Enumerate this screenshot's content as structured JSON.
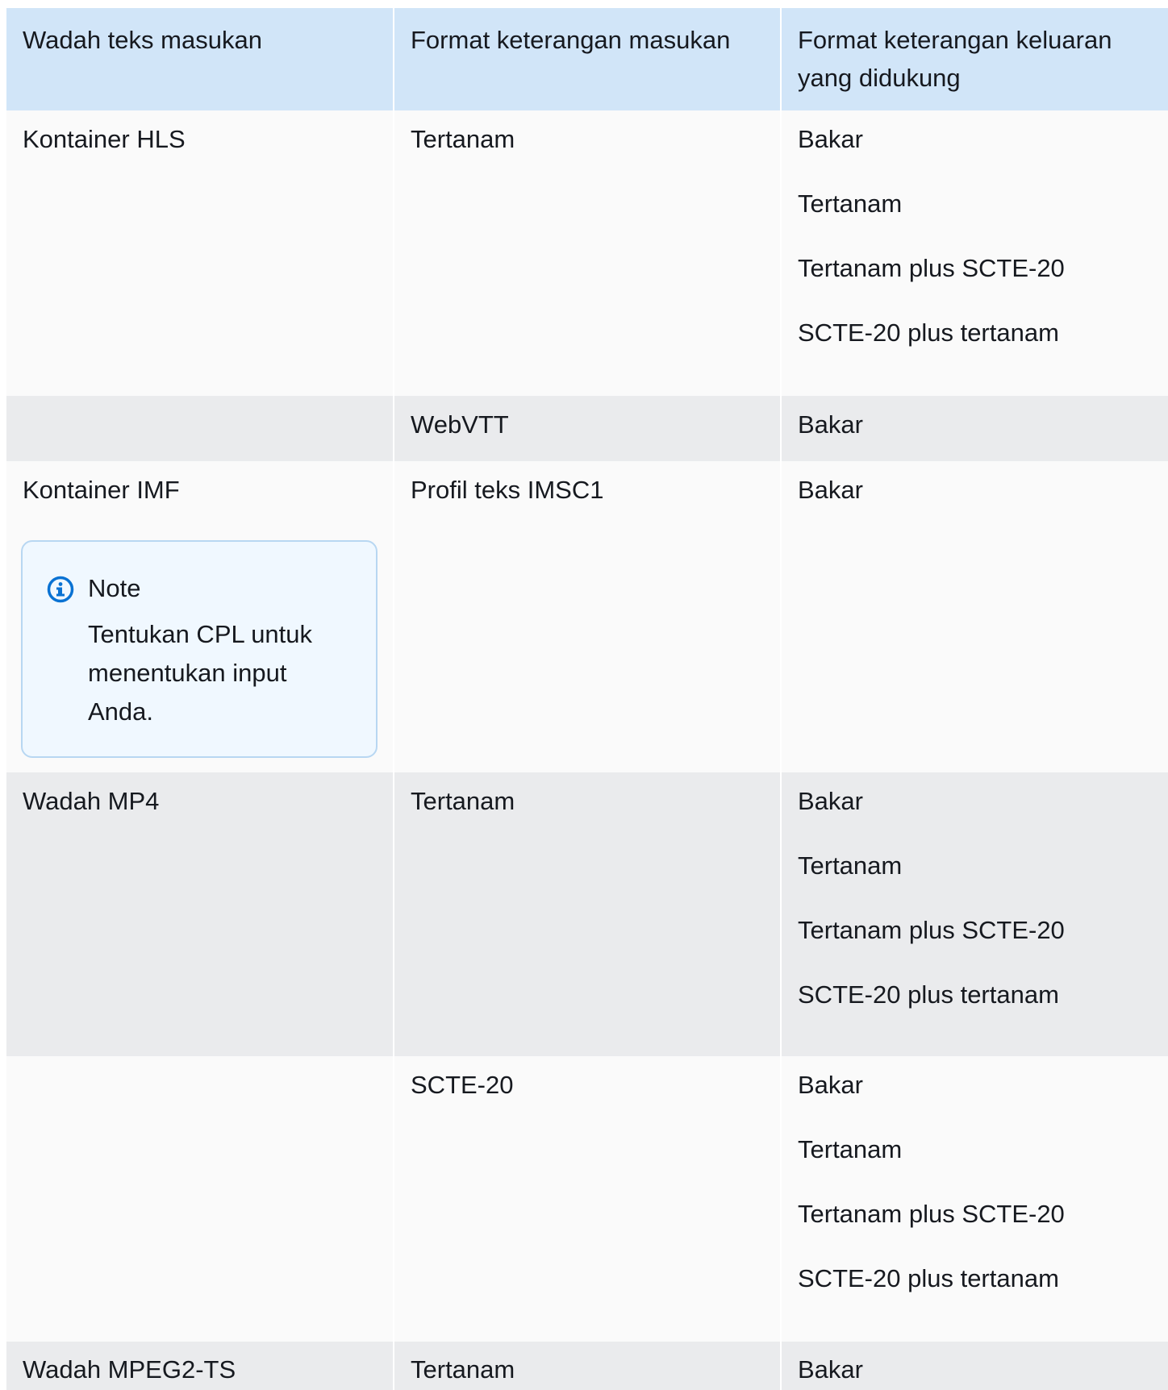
{
  "table": {
    "headers": [
      "Wadah teks masukan",
      "Format keterangan masukan",
      "Format keterangan keluaran yang didukung"
    ],
    "rows": [
      {
        "container": "Kontainer HLS",
        "input_format": "Tertanam",
        "outputs": [
          "Bakar",
          "Tertanam",
          "Tertanam plus SCTE-20",
          "SCTE-20 plus tertanam"
        ]
      },
      {
        "container": "",
        "input_format": "WebVTT",
        "outputs": [
          "Bakar"
        ]
      },
      {
        "container": "Kontainer IMF",
        "input_format": "Profil teks IMSC1",
        "outputs": [
          "Bakar"
        ],
        "note": {
          "title": "Note",
          "body": "Tentukan CPL untuk menentukan input Anda.",
          "icon": "info-icon"
        }
      },
      {
        "container": "Wadah MP4",
        "input_format": "Tertanam",
        "outputs": [
          "Bakar",
          "Tertanam",
          "Tertanam plus SCTE-20",
          "SCTE-20 plus tertanam"
        ]
      },
      {
        "container": "",
        "input_format": "SCTE-20",
        "outputs": [
          "Bakar",
          "Tertanam",
          "Tertanam plus SCTE-20",
          "SCTE-20 plus tertanam"
        ]
      },
      {
        "container": "Wadah MPEG2-TS",
        "input_format": "Tertanam",
        "outputs": [
          "Bakar"
        ]
      }
    ]
  },
  "colors": {
    "header_bg": "#d1e5f8",
    "row_light": "#fafafa",
    "row_shaded": "#eaebed",
    "note_bg": "#f0f8ff",
    "note_border": "#b8d7f2",
    "info_icon": "#0972d3"
  }
}
